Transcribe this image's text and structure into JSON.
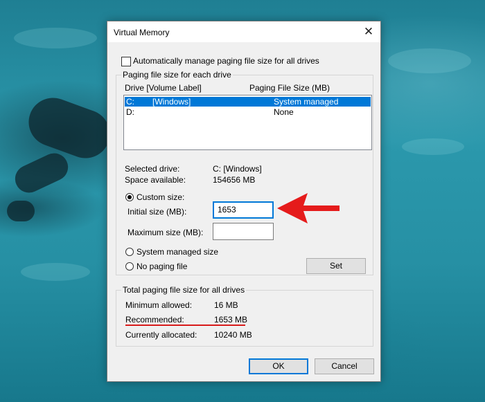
{
  "dialog": {
    "title": "Virtual Memory",
    "auto_manage_label": "Automatically manage paging file size for all drives",
    "auto_manage_checked": false
  },
  "per_drive": {
    "group_label": "Paging file size for each drive",
    "col_drive": "Drive  [Volume Label]",
    "col_size": "Paging File Size (MB)",
    "drives": [
      {
        "drive": "C:",
        "label": "[Windows]",
        "size": "System managed",
        "selected": true
      },
      {
        "drive": "D:",
        "label": "",
        "size": "None",
        "selected": false
      }
    ],
    "selected_drive_label": "Selected drive:",
    "selected_drive_value": "C:  [Windows]",
    "space_available_label": "Space available:",
    "space_available_value": "154656 MB",
    "custom_size_label": "Custom size:",
    "initial_size_label": "Initial size (MB):",
    "initial_size_value": "1653",
    "maximum_size_label": "Maximum size (MB):",
    "maximum_size_value": "",
    "system_managed_label": "System managed size",
    "no_paging_label": "No paging file",
    "set_label": "Set"
  },
  "totals": {
    "group_label": "Total paging file size for all drives",
    "min_allowed_label": "Minimum allowed:",
    "min_allowed_value": "16 MB",
    "recommended_label": "Recommended:",
    "recommended_value": "1653 MB",
    "currently_allocated_label": "Currently allocated:",
    "currently_allocated_value": "10240 MB"
  },
  "buttons": {
    "ok": "OK",
    "cancel": "Cancel"
  },
  "colors": {
    "accent": "#0078d7",
    "annotation": "#e51b1b"
  },
  "icons": {
    "close": "close-icon",
    "annotation": "red-arrow-icon"
  }
}
